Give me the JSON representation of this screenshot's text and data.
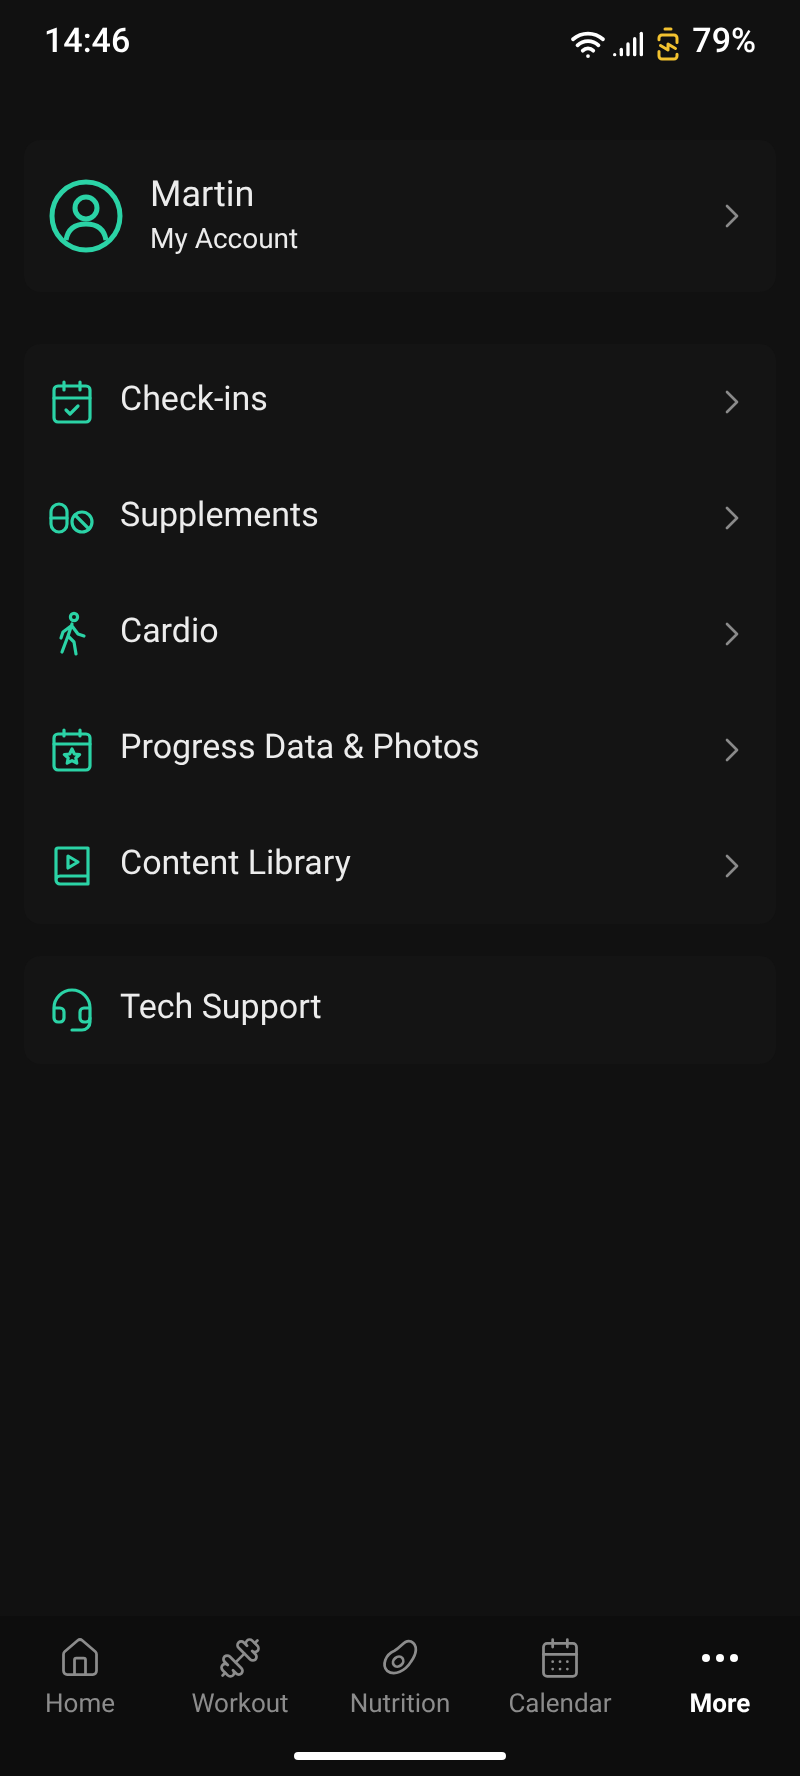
{
  "status_bar": {
    "time": "14:46",
    "battery": "79%"
  },
  "account": {
    "name": "Martin",
    "subtitle": "My Account"
  },
  "menu": [
    {
      "kind": "checkins",
      "label": "Check-ins"
    },
    {
      "kind": "supplements",
      "label": "Supplements"
    },
    {
      "kind": "cardio",
      "label": "Cardio"
    },
    {
      "kind": "progress",
      "label": "Progress Data & Photos"
    },
    {
      "kind": "library",
      "label": "Content Library"
    }
  ],
  "support": {
    "kind": "support",
    "label": "Tech Support"
  },
  "bottom_nav": [
    {
      "kind": "home",
      "label": "Home",
      "selected": false
    },
    {
      "kind": "workout",
      "label": "Workout",
      "selected": false
    },
    {
      "kind": "nutrition",
      "label": "Nutrition",
      "selected": false
    },
    {
      "kind": "calendar",
      "label": "Calendar",
      "selected": false
    },
    {
      "kind": "more",
      "label": "More",
      "selected": true
    }
  ]
}
